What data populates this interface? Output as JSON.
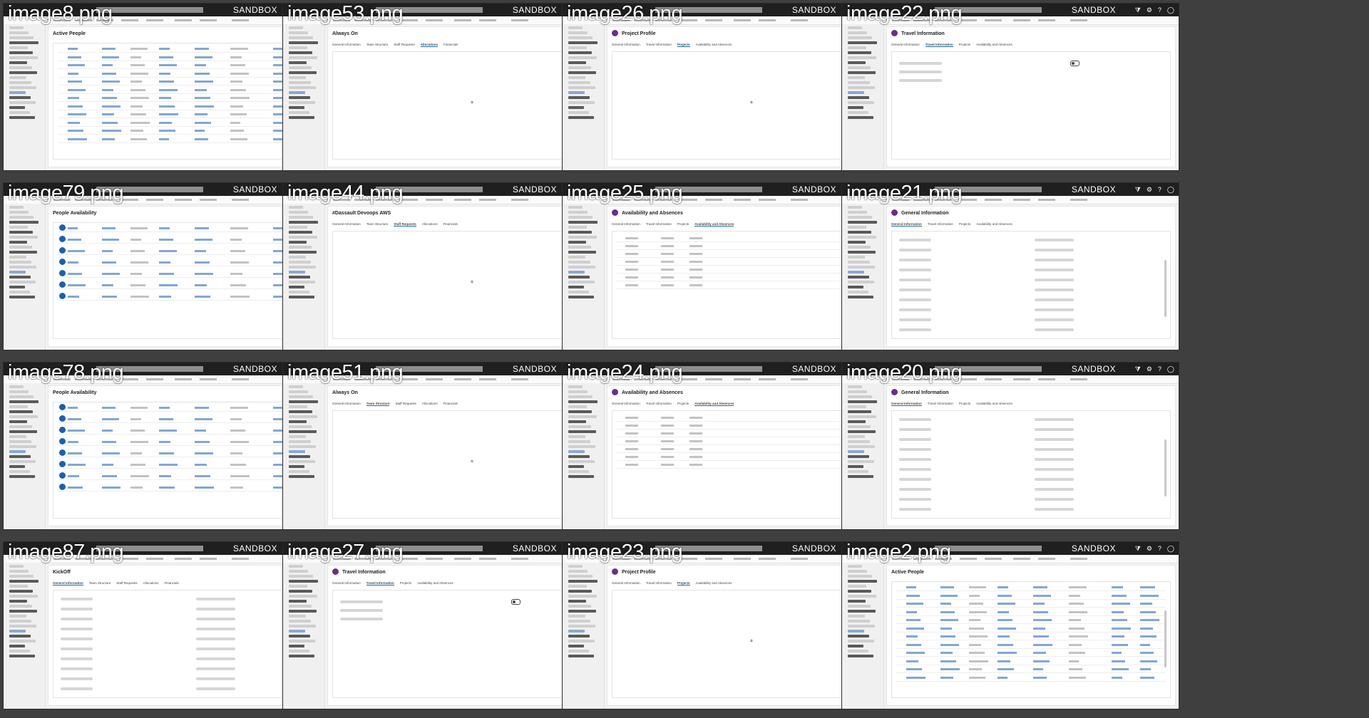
{
  "environment_label": "SANDBOX",
  "topbar_icons": [
    "filter-icon",
    "gear-icon",
    "help-icon",
    "user-circle-icon"
  ],
  "tiles": [
    {
      "caption": "image8.png",
      "kind": "active-people",
      "title": "Active People",
      "count_rows": 12
    },
    {
      "caption": "image53.png",
      "kind": "project-empty",
      "title": "Always On",
      "tabs": [
        "General Information",
        "Team Structure",
        "Staff Requests",
        "Allocations",
        "Financials"
      ],
      "active_tab": 3
    },
    {
      "caption": "image26.png",
      "kind": "projects-empty",
      "title": "Project Profile",
      "tabs": [
        "General Information",
        "Travel Information",
        "Projects",
        "Availability and Absences"
      ],
      "active_tab": 2
    },
    {
      "caption": "image22.png",
      "kind": "travel-info",
      "title": "Travel Information",
      "tabs": [
        "General Information",
        "Travel Information",
        "Projects",
        "Availability and Absences"
      ],
      "active_tab": 1
    },
    {
      "caption": "image79.png",
      "kind": "people-availability",
      "title": "People Availability",
      "count_rows": 7
    },
    {
      "caption": "image44.png",
      "kind": "staff-requests",
      "title": "#Dassault Devoops AWS",
      "tabs": [
        "General Information",
        "Team Structure",
        "Staff Requests",
        "Allocations",
        "Financials"
      ],
      "active_tab": 2
    },
    {
      "caption": "image25.png",
      "kind": "availability",
      "title": "Availability and Absences",
      "tabs": [
        "General Information",
        "Travel Information",
        "Projects",
        "Availability and Absences"
      ],
      "active_tab": 3
    },
    {
      "caption": "image21.png",
      "kind": "general-info-scroll",
      "title": "General Information",
      "tabs": [
        "General Information",
        "Travel Information",
        "Projects",
        "Availability and Absences"
      ],
      "active_tab": 0
    },
    {
      "caption": "image78.png",
      "kind": "people-availability",
      "title": "People Availability",
      "count_rows": 8
    },
    {
      "caption": "image51.png",
      "kind": "team-empty",
      "title": "Always On",
      "tabs": [
        "General Information",
        "Team Structure",
        "Staff Requests",
        "Allocations",
        "Financials"
      ],
      "active_tab": 1
    },
    {
      "caption": "image24.png",
      "kind": "availability",
      "title": "Availability and Absences",
      "tabs": [
        "General Information",
        "Travel Information",
        "Projects",
        "Availability and Absences"
      ],
      "active_tab": 3
    },
    {
      "caption": "image20.png",
      "kind": "general-info",
      "title": "General Information",
      "tabs": [
        "General Information",
        "Travel Information",
        "Projects",
        "Availability and Absences"
      ],
      "active_tab": 0
    },
    {
      "caption": "image87.png",
      "kind": "project-form",
      "title": "KickOff",
      "tabs": [
        "General Information",
        "Team Structure",
        "Staff Requests",
        "Allocations",
        "Financials"
      ],
      "active_tab": 0
    },
    {
      "caption": "image27.png",
      "kind": "travel-info",
      "title": "Travel Information",
      "tabs": [
        "General Information",
        "Travel Information",
        "Projects",
        "Availability and Absences"
      ],
      "active_tab": 1
    },
    {
      "caption": "image23.png",
      "kind": "projects-empty",
      "title": "Project Profile",
      "tabs": [
        "General Information",
        "Travel Information",
        "Projects",
        "Availability and Absences"
      ],
      "active_tab": 2
    },
    {
      "caption": "image2.png",
      "kind": "active-people",
      "title": "Active People",
      "count_rows": 12
    }
  ]
}
